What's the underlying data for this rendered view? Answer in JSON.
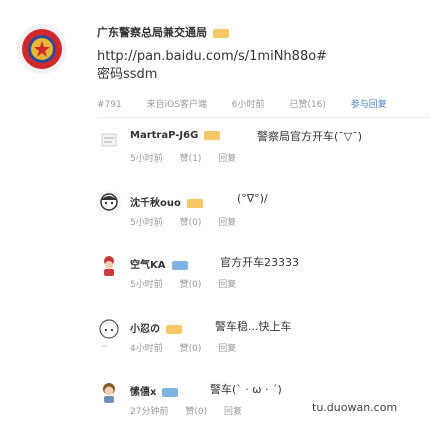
{
  "post": {
    "poster": "广东警察总局兼交通局",
    "link_text": "http://pan.baidu.com/s/1miNh88o#",
    "password_text": "密码ssdm",
    "meta": {
      "floor": "#791",
      "source": "来自iOS客户端",
      "time": "6小时前",
      "likes": "已赞(16)",
      "reply": "参与回复"
    }
  },
  "comments": [
    {
      "name": "MartraP-J6G",
      "text": "警察局官方开车(¯▽¯)",
      "time": "5小时前",
      "likes": "赞(1)",
      "reply": "回复"
    },
    {
      "name": "沈千秋ouo",
      "text": "(°∇°)/",
      "time": "5小时前",
      "likes": "赞(0)",
      "reply": "回复"
    },
    {
      "name": "空气KA",
      "text": "官方开车23333",
      "time": "5小时前",
      "likes": "赞(0)",
      "reply": "回复"
    },
    {
      "name": "小忍の",
      "text": "警车稳...快上车",
      "time": "4小时前",
      "likes": "赞(0)",
      "reply": "回复"
    },
    {
      "name": "愫僖x",
      "text": "警车(` · ω · ´)",
      "time": "27分钟前",
      "likes": "赞(0)",
      "reply": "回复"
    }
  ],
  "watermark": "tu.duowan.com",
  "colors": {
    "link": "#4a7fc1",
    "meta": "#999999",
    "vip": "#f5c765"
  }
}
